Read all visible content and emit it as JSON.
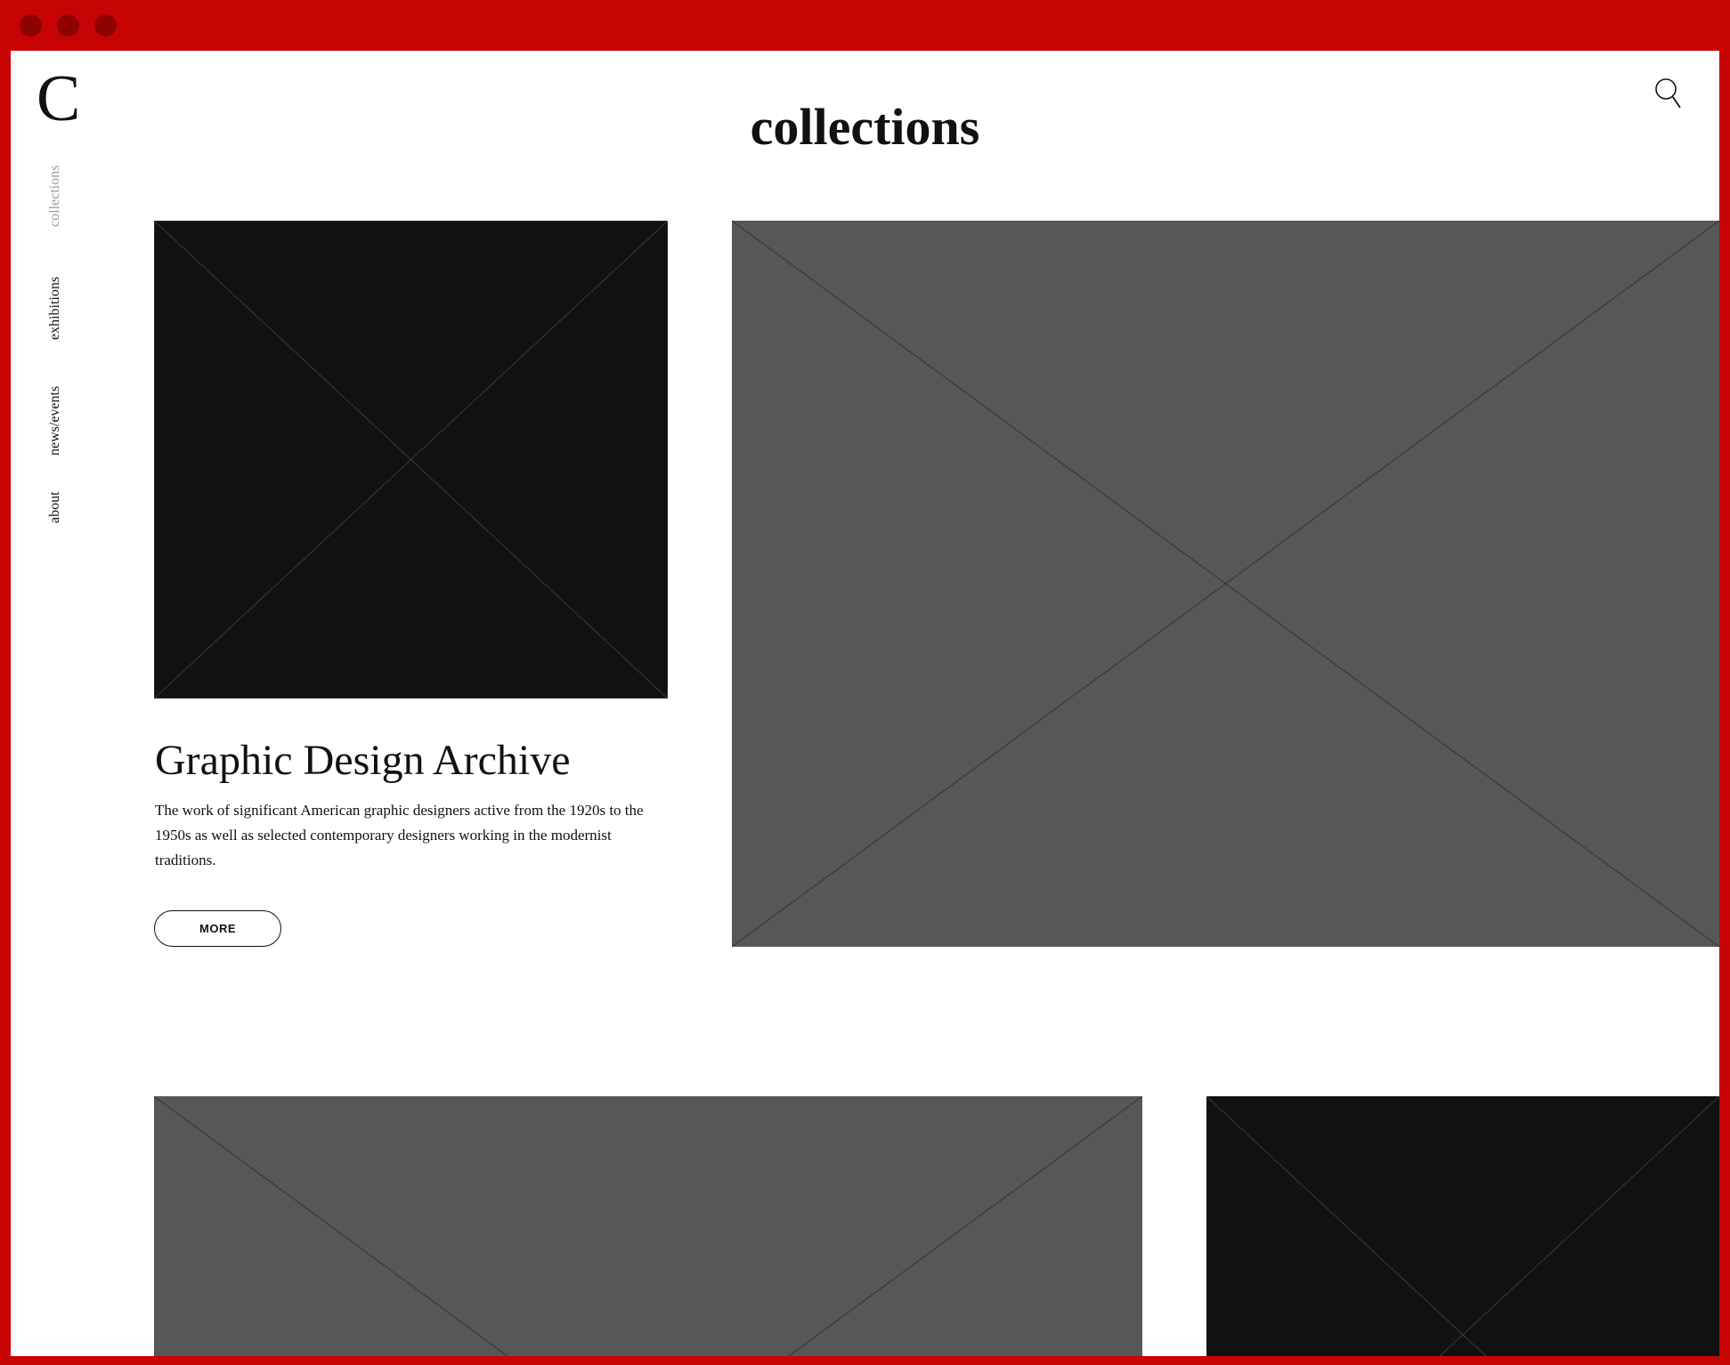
{
  "window": {
    "controls": [
      "close",
      "minimize",
      "maximize"
    ],
    "frame_color": "#c80303"
  },
  "header": {
    "logo": "C",
    "title": "collections",
    "search_icon": "search-icon"
  },
  "nav": {
    "items": [
      {
        "label": "collections",
        "active": true
      },
      {
        "label": "exhibitions",
        "active": false
      },
      {
        "label": "news/events",
        "active": false
      },
      {
        "label": "about",
        "active": false
      }
    ]
  },
  "feature": {
    "title": "Graphic Design Archive",
    "description": "The work of significant American graphic designers active from the 1920s to the 1950s as well as selected contemporary designers working in the modernist traditions.",
    "more_label": "MORE"
  },
  "placeholders": {
    "dark": "#111111",
    "gray": "#575757"
  }
}
